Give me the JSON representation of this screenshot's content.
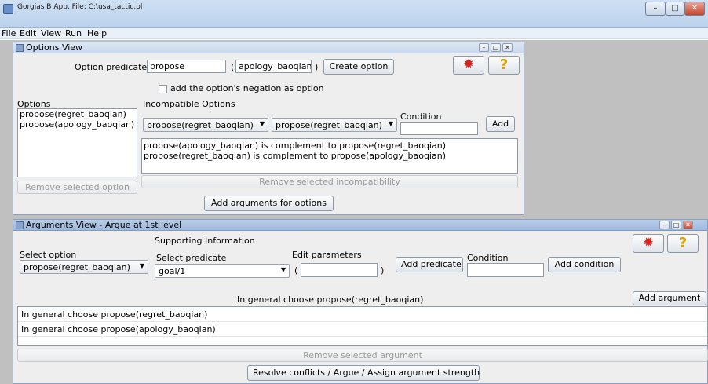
{
  "window": {
    "title": "Gorgias B App, File: C:\\usa_tactic.pl",
    "minimize": "–",
    "maximize": "□",
    "close": "✕"
  },
  "menubar": {
    "items": [
      "File",
      "Edit",
      "View",
      "Run",
      "Help"
    ]
  },
  "options_view": {
    "title": "Options View",
    "option_predicate_label": "Option predicate:",
    "predicate_value": "propose",
    "paren_open": "(",
    "argument_value": "apology_baoqian",
    "paren_close": ")",
    "create_option_button": "Create option",
    "negation_checkbox_label": "add the option's negation as option",
    "negation_checked": false,
    "options_label": "Options",
    "options": [
      "propose(regret_baoqian)",
      "propose(apology_baoqian)"
    ],
    "remove_selected_option_button": "Remove selected option",
    "incompatible_options_label": "Incompatible Options",
    "incompatible_left_select": "propose(regret_baoqian)",
    "incompatible_right_select": "propose(regret_baoqian)",
    "condition_label": "Condition",
    "condition_value": "",
    "add_button": "Add",
    "incompatibilities": [
      "propose(apology_baoqian) is complement to propose(regret_baoqian)",
      "propose(regret_baoqian) is complement to propose(apology_baoqian)"
    ],
    "remove_selected_incompatibility_button": "Remove selected incompatibility",
    "add_arguments_button": "Add arguments for options"
  },
  "arguments_view": {
    "title": "Arguments View - Argue at 1st level",
    "supporting_information_label": "Supporting Information",
    "select_option_label": "Select option",
    "select_option_value": "propose(regret_baoqian)",
    "select_predicate_label": "Select predicate",
    "select_predicate_value": "goal/1",
    "edit_parameters_label": "Edit parameters",
    "paren_open": "(",
    "parameters_value": "",
    "paren_close": ")",
    "add_predicate_button": "Add predicate",
    "condition_label": "Condition",
    "condition_value": "",
    "add_condition_button": "Add condition",
    "current_argument_text": "In general choose propose(regret_baoqian)",
    "add_argument_button": "Add argument",
    "arguments": [
      "In general choose propose(regret_baoqian)",
      "In general choose propose(apology_baoqian)"
    ],
    "remove_selected_argument_button": "Remove selected argument",
    "resolve_button": "Resolve conflicts / Argue / Assign argument strength"
  },
  "icons": {
    "stop": "stop-icon",
    "help": "help-icon"
  },
  "colors": {
    "help_icon": "#e0a000",
    "stop_icon": "#d8231c",
    "desktop": "#c0c0c0"
  }
}
